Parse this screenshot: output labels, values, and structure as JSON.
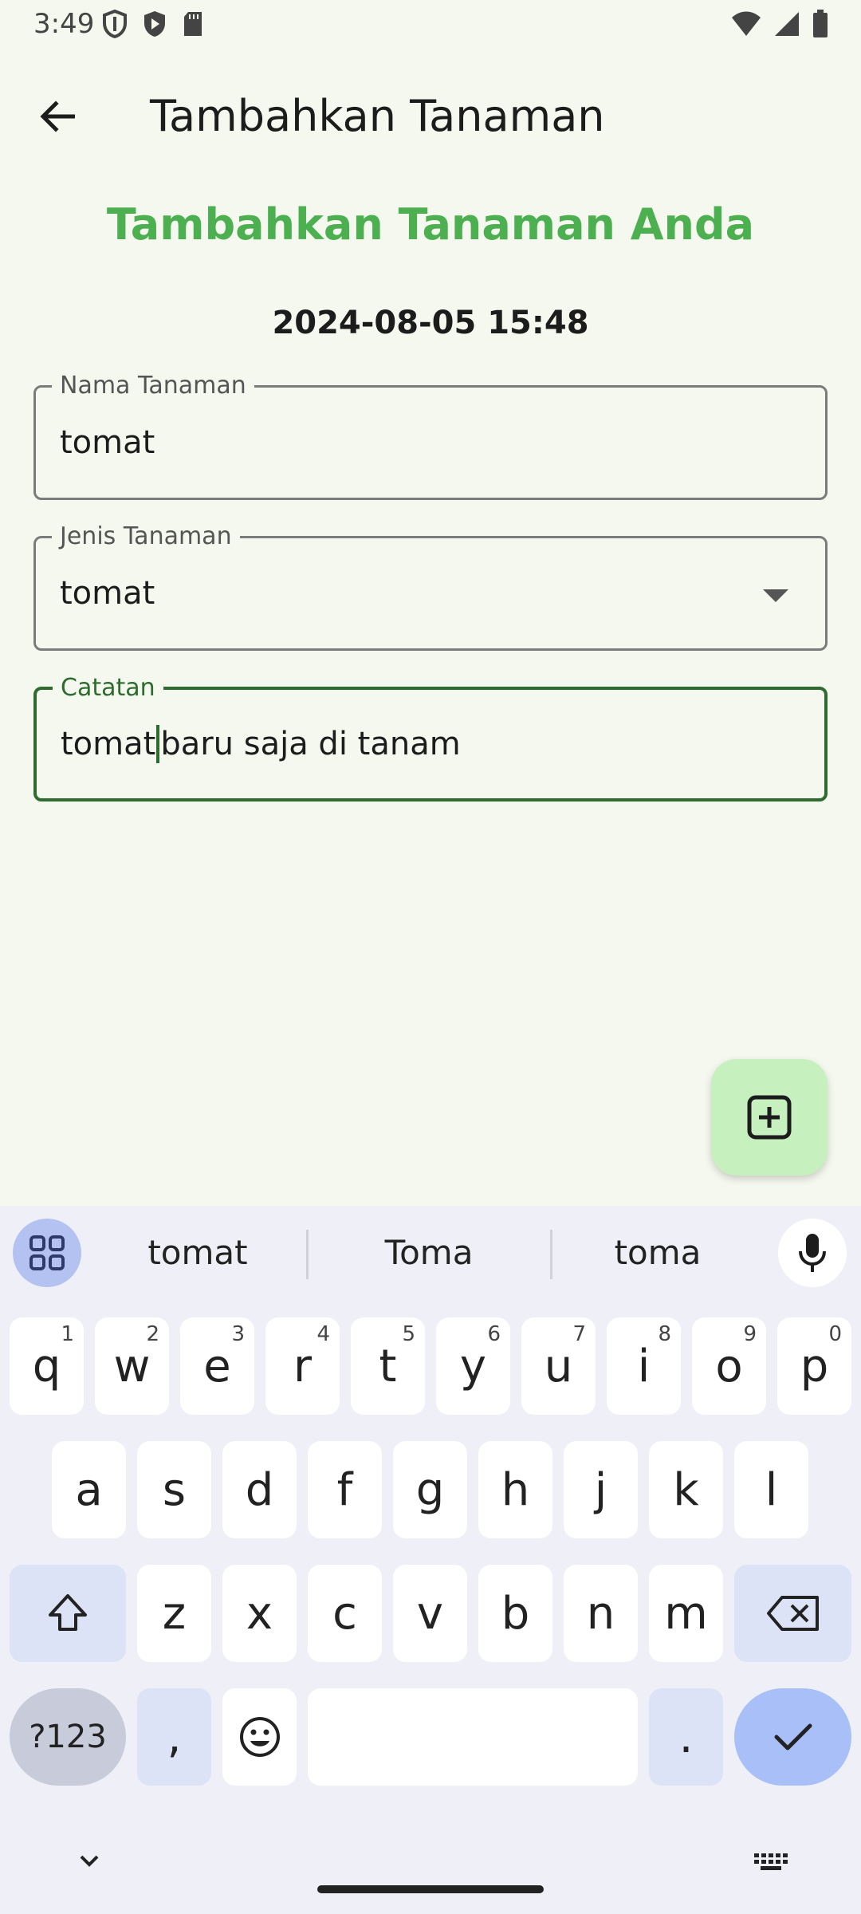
{
  "status_bar": {
    "time": "3:49"
  },
  "app_bar": {
    "title": "Tambahkan Tanaman"
  },
  "form": {
    "heading": "Tambahkan Tanaman Anda",
    "datetime": "2024-08-05 15:48",
    "fields": [
      {
        "label": "Nama Tanaman",
        "value": "tomat"
      },
      {
        "label": "Jenis Tanaman",
        "value": "tomat"
      },
      {
        "label": "Catatan",
        "value_before_cursor": "tomat",
        "value_after_cursor": "baru saja di tanam"
      }
    ]
  },
  "keyboard": {
    "suggestions": [
      "tomat",
      "Toma",
      "toma"
    ],
    "row1": [
      {
        "key": "q",
        "hint": "1"
      },
      {
        "key": "w",
        "hint": "2"
      },
      {
        "key": "e",
        "hint": "3"
      },
      {
        "key": "r",
        "hint": "4"
      },
      {
        "key": "t",
        "hint": "5"
      },
      {
        "key": "y",
        "hint": "6"
      },
      {
        "key": "u",
        "hint": "7"
      },
      {
        "key": "i",
        "hint": "8"
      },
      {
        "key": "o",
        "hint": "9"
      },
      {
        "key": "p",
        "hint": "0"
      }
    ],
    "row2": [
      "a",
      "s",
      "d",
      "f",
      "g",
      "h",
      "j",
      "k",
      "l"
    ],
    "row3": [
      "z",
      "x",
      "c",
      "v",
      "b",
      "n",
      "m"
    ],
    "symbols_label": "?123",
    "comma": ",",
    "period": "."
  },
  "colors": {
    "accent_green": "#4caf50",
    "focus_green": "#2e6b2e",
    "fab_bg": "#c6f0bd",
    "enter_key": "#a8c0f7"
  },
  "icons": [
    "shield-icon",
    "play-protect-icon",
    "sd-card-icon",
    "wifi-icon",
    "signal-icon",
    "battery-icon",
    "back-arrow-icon",
    "add-box-icon",
    "apps-grid-icon",
    "mic-icon",
    "shift-icon",
    "backspace-icon",
    "emoji-icon",
    "check-icon",
    "chevron-down-icon",
    "keyboard-icon"
  ]
}
